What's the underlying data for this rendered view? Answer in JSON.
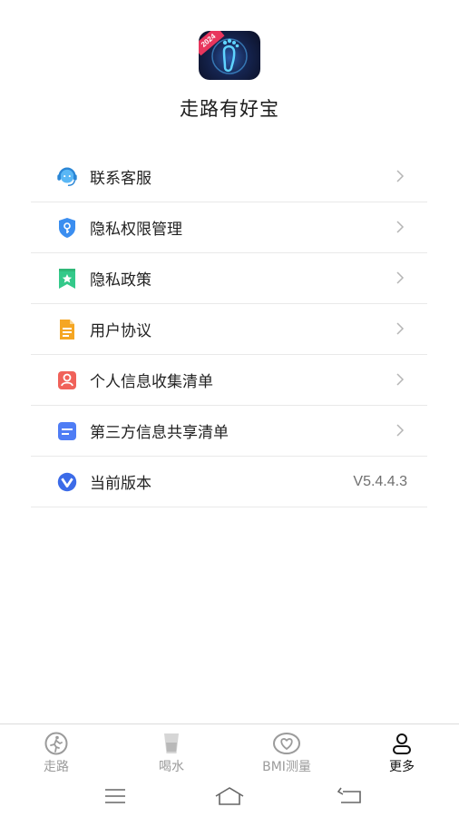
{
  "app": {
    "name": "走路有好宝",
    "badge": "2024",
    "logo_icon": "footprint-icon"
  },
  "menu": [
    {
      "label": "联系客服",
      "icon": "customer-service-icon",
      "color": "#3aa0f0"
    },
    {
      "label": "隐私权限管理",
      "icon": "privacy-shield-icon",
      "color": "#3b8ef0"
    },
    {
      "label": "隐私政策",
      "icon": "policy-star-icon",
      "color": "#34c98a"
    },
    {
      "label": "用户协议",
      "icon": "document-icon",
      "color": "#f5a623"
    },
    {
      "label": "个人信息收集清单",
      "icon": "personal-info-icon",
      "color": "#f0625a"
    },
    {
      "label": "第三方信息共享清单",
      "icon": "share-list-icon",
      "color": "#4f7df5"
    },
    {
      "label": "当前版本",
      "icon": "version-v-icon",
      "color": "#3c6be8",
      "value": "V5.4.4.3"
    }
  ],
  "tabs": [
    {
      "label": "走路",
      "icon": "walk-icon",
      "active": false
    },
    {
      "label": "喝水",
      "icon": "water-cup-icon",
      "active": false
    },
    {
      "label": "BMI测量",
      "icon": "heart-icon",
      "active": false
    },
    {
      "label": "更多",
      "icon": "user-icon",
      "active": true
    }
  ],
  "system_nav": [
    "menu-icon",
    "home-icon",
    "back-icon"
  ]
}
